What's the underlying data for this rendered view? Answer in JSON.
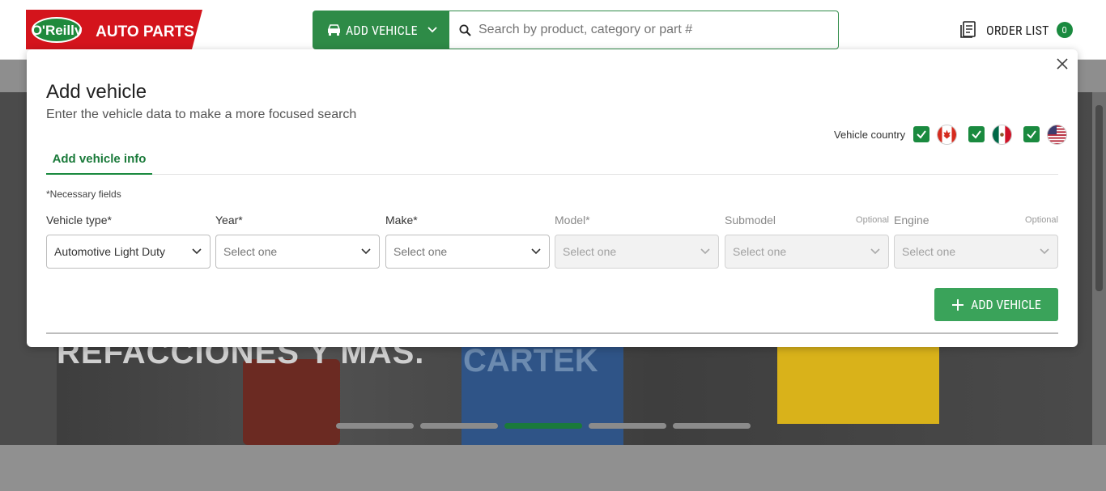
{
  "header": {
    "logo_text": "O'Reilly AUTO PARTS",
    "add_vehicle_label": "ADD VEHICLE",
    "search_placeholder": "Search by product, category or part #",
    "order_list_label": "ORDER LIST",
    "order_count": "0"
  },
  "hero": {
    "headline": "REFACCIONES Y MÁS.",
    "brand": "CARTEK",
    "carousel_slides": 5,
    "active_slide": 3
  },
  "modal": {
    "title": "Add vehicle",
    "subtitle": "Enter the vehicle data to make a more focused search",
    "country_label": "Vehicle country",
    "countries": [
      {
        "name": "Canada",
        "checked": true
      },
      {
        "name": "Mexico",
        "checked": true
      },
      {
        "name": "USA",
        "checked": true
      }
    ],
    "tab_label": "Add vehicle info",
    "necessary_note": "*Necessary fields",
    "fields": [
      {
        "label": "Vehicle type*",
        "optional": "",
        "value": "Automotive Light Duty",
        "disabled": false
      },
      {
        "label": "Year*",
        "optional": "",
        "value": "Select one",
        "disabled": false
      },
      {
        "label": "Make*",
        "optional": "",
        "value": "Select one",
        "disabled": false
      },
      {
        "label": "Model*",
        "optional": "",
        "value": "Select one",
        "disabled": true
      },
      {
        "label": "Submodel",
        "optional": "Optional",
        "value": "Select one",
        "disabled": true
      },
      {
        "label": "Engine",
        "optional": "Optional",
        "value": "Select one",
        "disabled": true
      }
    ],
    "add_button_label": "ADD VEHICLE"
  },
  "colors": {
    "brand_green": "#2e8b47",
    "brand_red": "#d4141c",
    "badge_green": "#1a8a3f"
  }
}
